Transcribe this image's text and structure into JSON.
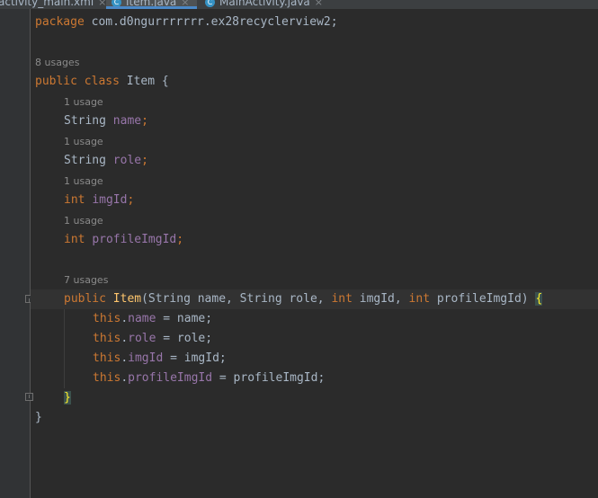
{
  "tabs": [
    {
      "label": "activity_main.xml",
      "close": "×",
      "active": false
    },
    {
      "label": "Item.java",
      "close": "×",
      "active": true,
      "icon": "C"
    },
    {
      "label": "MainActivity.java",
      "close": "×",
      "active": false,
      "icon": "C"
    }
  ],
  "code": {
    "package_kw": "package",
    "package_name": " com.d0ngurrrrrrr.ex28recyclerview2;",
    "class_usages": "8 usages",
    "public_kw": "public",
    "class_kw": "class",
    "class_name": " Item {",
    "field_usage_1": "1 usage",
    "field_usage_2": "1 usage",
    "field_usage_3": "1 usage",
    "field_usage_4": "1 usage",
    "type_string": "String",
    "type_int": "int",
    "field_name": "name",
    "field_role": "role",
    "field_imgId": "imgId",
    "field_profileImgId": "profileImgId",
    "semicolon": ";",
    "ctor_usages": "7 usages",
    "ctor_name": "Item",
    "ctor_params_1": "(String name, String role, ",
    "ctor_params_2": " imgId, ",
    "ctor_params_3": " profileImgId) ",
    "open_brace": "{",
    "this_kw": "this",
    "assign_name": " = name;",
    "assign_role": " = role;",
    "assign_imgId": " = imgId;",
    "assign_profileImgId": " = profileImgId;",
    "close_brace": "}",
    "class_close": "}"
  },
  "colors": {
    "background": "#2b2b2b",
    "keyword": "#cc7832",
    "field": "#9876aa",
    "method": "#ffc66d",
    "text": "#a9b7c6",
    "brace_highlight": "#ffef28"
  }
}
